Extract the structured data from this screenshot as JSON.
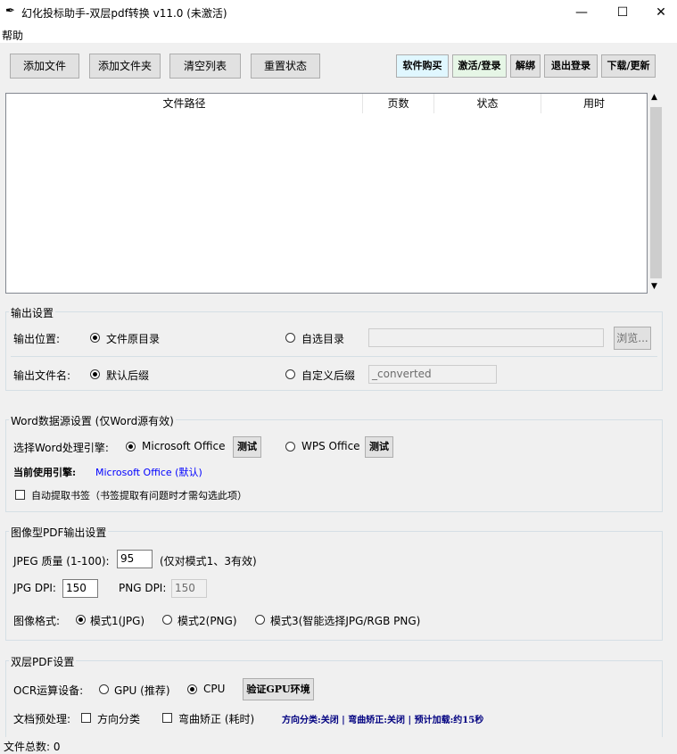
{
  "window": {
    "title": "幻化投标助手-双层pdf转换 v11.0 (未激活)",
    "minimize": "—",
    "maximize": "☐",
    "close": "✕"
  },
  "menu": {
    "help": "帮助"
  },
  "toolbar": {
    "add_file": "添加文件",
    "add_folder": "添加文件夹",
    "clear_list": "清空列表",
    "reset_status": "重置状态",
    "buy": "软件购买",
    "activate": "激活/登录",
    "unbind": "解绑",
    "logout": "退出登录",
    "download": "下载/更新"
  },
  "table": {
    "columns": [
      "文件路径",
      "页数",
      "状态",
      "用时"
    ],
    "rows": []
  },
  "output": {
    "group_title": "输出设置",
    "location_label": "输出位置:",
    "opt_source_dir": "文件原目录",
    "opt_custom_dir": "自选目录",
    "custom_dir_value": "",
    "browse": "浏览...",
    "filename_label": "输出文件名:",
    "opt_default_suffix": "默认后缀",
    "opt_custom_suffix": "自定义后缀",
    "suffix_value": "_converted"
  },
  "word": {
    "group_title": "Word数据源设置 (仅Word源有效)",
    "engine_label": "选择Word处理引擎:",
    "opt_ms": "Microsoft Office",
    "test": "测试",
    "opt_wps": "WPS Office",
    "current_label": "当前使用引擎:",
    "current_value": "Microsoft Office (默认)",
    "bookmark_label": "自动提取书签（书签提取有问题时才需勾选此项）"
  },
  "image": {
    "group_title": "图像型PDF输出设置",
    "jpeg_quality_label": "JPEG 质量 (1-100):",
    "jpeg_quality_value": "95",
    "jpeg_quality_note": "(仅对模式1、3有效)",
    "jpg_dpi_label": "JPG DPI:",
    "jpg_dpi_value": "150",
    "png_dpi_label": "PNG DPI:",
    "png_dpi_value": "150",
    "format_label": "图像格式:",
    "mode1": "模式1(JPG)",
    "mode2": "模式2(PNG)",
    "mode3": "模式3(智能选择JPG/RGB PNG)"
  },
  "dual": {
    "group_title": "双层PDF设置",
    "ocr_label": "OCR运算设备:",
    "gpu": "GPU (推荐)",
    "cpu": "CPU",
    "verify_gpu": "验证GPU环境",
    "preprocess_label": "文档预处理:",
    "orientation": "方向分类",
    "dewarp": "弯曲矫正 (耗时)",
    "summary": "方向分类:关闭 | 弯曲矫正:关闭 | 预计加载:约15秒"
  },
  "status": {
    "file_count": "文件总数: 0"
  },
  "colors": {
    "blue_text": "#0000ff",
    "navy_text": "#000080",
    "buy_bg": "#e0f7ff",
    "activate_bg": "#e6f6e6"
  }
}
